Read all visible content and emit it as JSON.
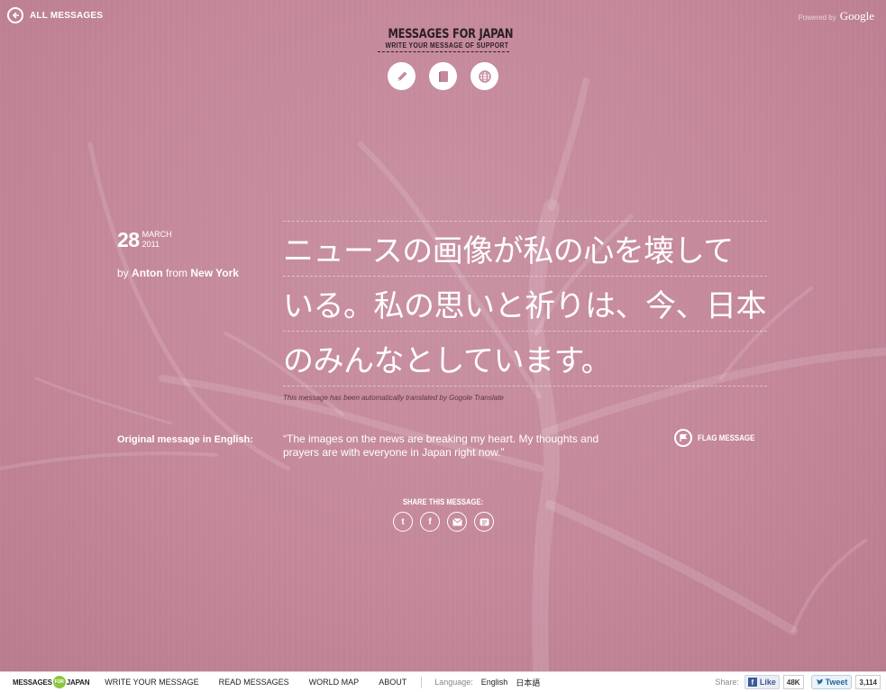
{
  "header": {
    "back_label": "ALL MESSAGES",
    "powered_by": "Powered by",
    "powered_brand": "Google",
    "logo_title": "MESSAGES FOR JAPAN",
    "logo_subtitle": "WRITE YOUR MESSAGE OF SUPPORT",
    "icons": [
      "pencil-icon",
      "book-icon",
      "globe-icon"
    ]
  },
  "message": {
    "day": "28",
    "month": "MARCH",
    "year": "2011",
    "by": "by",
    "author": "Anton",
    "from": "from",
    "location": "New York",
    "japanese_lines": [
      "ニュースの画像が私の心を壊して",
      "いる。私の思いと祈りは、今、日本",
      "のみんなとしています。"
    ],
    "translation_note": "This message has been automatically translated by Gogole Translate",
    "original_label": "Original message in English:",
    "original_text": "“The images on the news are breaking my heart. My thoughts and prayers are with everyone in Japan right now.”",
    "flag_label": "FLAG MESSAGE"
  },
  "share": {
    "title": "SHARE THIS MESSAGE:",
    "icons": [
      "twitter-icon",
      "facebook-icon",
      "email-icon",
      "link-icon"
    ]
  },
  "footer": {
    "logo_left": "MESSAGES",
    "logo_for": "FOR",
    "logo_right": "JAPAN",
    "nav": [
      "WRITE YOUR MESSAGE",
      "READ MESSAGES",
      "WORLD MAP",
      "ABOUT"
    ],
    "language_label": "Language:",
    "languages": [
      "English",
      "日本語"
    ],
    "share_label": "Share:",
    "like_label": "Like",
    "like_count": "48K",
    "tweet_label": "Tweet",
    "tweet_count": "3,114"
  },
  "colors": {
    "background": "#c6899b",
    "logo_text": "#2b1f24",
    "facebook": "#3b5998",
    "for_badge": "#8cc63f"
  }
}
